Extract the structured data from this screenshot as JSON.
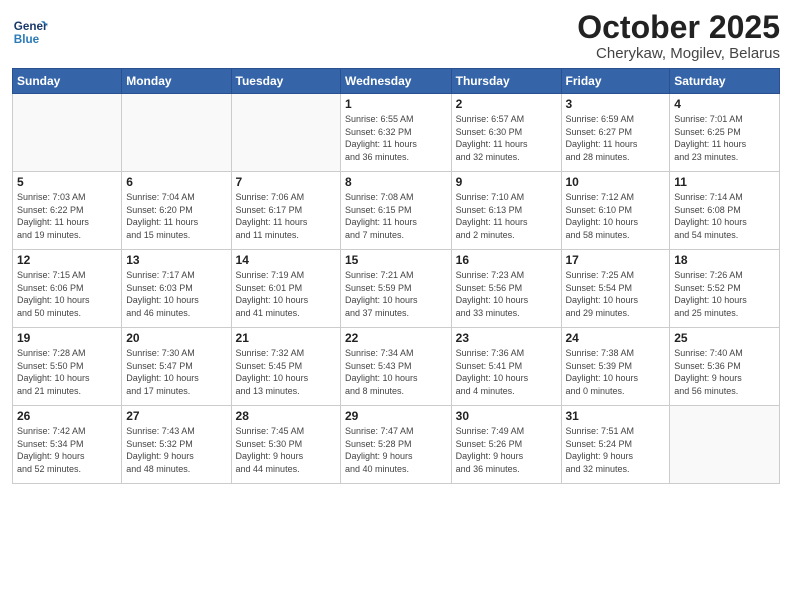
{
  "header": {
    "logo_line1": "General",
    "logo_line2": "Blue",
    "title": "October 2025",
    "subtitle": "Cherykaw, Mogilev, Belarus"
  },
  "calendar": {
    "days_of_week": [
      "Sunday",
      "Monday",
      "Tuesday",
      "Wednesday",
      "Thursday",
      "Friday",
      "Saturday"
    ],
    "weeks": [
      [
        {
          "day": "",
          "info": ""
        },
        {
          "day": "",
          "info": ""
        },
        {
          "day": "",
          "info": ""
        },
        {
          "day": "1",
          "info": "Sunrise: 6:55 AM\nSunset: 6:32 PM\nDaylight: 11 hours\nand 36 minutes."
        },
        {
          "day": "2",
          "info": "Sunrise: 6:57 AM\nSunset: 6:30 PM\nDaylight: 11 hours\nand 32 minutes."
        },
        {
          "day": "3",
          "info": "Sunrise: 6:59 AM\nSunset: 6:27 PM\nDaylight: 11 hours\nand 28 minutes."
        },
        {
          "day": "4",
          "info": "Sunrise: 7:01 AM\nSunset: 6:25 PM\nDaylight: 11 hours\nand 23 minutes."
        }
      ],
      [
        {
          "day": "5",
          "info": "Sunrise: 7:03 AM\nSunset: 6:22 PM\nDaylight: 11 hours\nand 19 minutes."
        },
        {
          "day": "6",
          "info": "Sunrise: 7:04 AM\nSunset: 6:20 PM\nDaylight: 11 hours\nand 15 minutes."
        },
        {
          "day": "7",
          "info": "Sunrise: 7:06 AM\nSunset: 6:17 PM\nDaylight: 11 hours\nand 11 minutes."
        },
        {
          "day": "8",
          "info": "Sunrise: 7:08 AM\nSunset: 6:15 PM\nDaylight: 11 hours\nand 7 minutes."
        },
        {
          "day": "9",
          "info": "Sunrise: 7:10 AM\nSunset: 6:13 PM\nDaylight: 11 hours\nand 2 minutes."
        },
        {
          "day": "10",
          "info": "Sunrise: 7:12 AM\nSunset: 6:10 PM\nDaylight: 10 hours\nand 58 minutes."
        },
        {
          "day": "11",
          "info": "Sunrise: 7:14 AM\nSunset: 6:08 PM\nDaylight: 10 hours\nand 54 minutes."
        }
      ],
      [
        {
          "day": "12",
          "info": "Sunrise: 7:15 AM\nSunset: 6:06 PM\nDaylight: 10 hours\nand 50 minutes."
        },
        {
          "day": "13",
          "info": "Sunrise: 7:17 AM\nSunset: 6:03 PM\nDaylight: 10 hours\nand 46 minutes."
        },
        {
          "day": "14",
          "info": "Sunrise: 7:19 AM\nSunset: 6:01 PM\nDaylight: 10 hours\nand 41 minutes."
        },
        {
          "day": "15",
          "info": "Sunrise: 7:21 AM\nSunset: 5:59 PM\nDaylight: 10 hours\nand 37 minutes."
        },
        {
          "day": "16",
          "info": "Sunrise: 7:23 AM\nSunset: 5:56 PM\nDaylight: 10 hours\nand 33 minutes."
        },
        {
          "day": "17",
          "info": "Sunrise: 7:25 AM\nSunset: 5:54 PM\nDaylight: 10 hours\nand 29 minutes."
        },
        {
          "day": "18",
          "info": "Sunrise: 7:26 AM\nSunset: 5:52 PM\nDaylight: 10 hours\nand 25 minutes."
        }
      ],
      [
        {
          "day": "19",
          "info": "Sunrise: 7:28 AM\nSunset: 5:50 PM\nDaylight: 10 hours\nand 21 minutes."
        },
        {
          "day": "20",
          "info": "Sunrise: 7:30 AM\nSunset: 5:47 PM\nDaylight: 10 hours\nand 17 minutes."
        },
        {
          "day": "21",
          "info": "Sunrise: 7:32 AM\nSunset: 5:45 PM\nDaylight: 10 hours\nand 13 minutes."
        },
        {
          "day": "22",
          "info": "Sunrise: 7:34 AM\nSunset: 5:43 PM\nDaylight: 10 hours\nand 8 minutes."
        },
        {
          "day": "23",
          "info": "Sunrise: 7:36 AM\nSunset: 5:41 PM\nDaylight: 10 hours\nand 4 minutes."
        },
        {
          "day": "24",
          "info": "Sunrise: 7:38 AM\nSunset: 5:39 PM\nDaylight: 10 hours\nand 0 minutes."
        },
        {
          "day": "25",
          "info": "Sunrise: 7:40 AM\nSunset: 5:36 PM\nDaylight: 9 hours\nand 56 minutes."
        }
      ],
      [
        {
          "day": "26",
          "info": "Sunrise: 7:42 AM\nSunset: 5:34 PM\nDaylight: 9 hours\nand 52 minutes."
        },
        {
          "day": "27",
          "info": "Sunrise: 7:43 AM\nSunset: 5:32 PM\nDaylight: 9 hours\nand 48 minutes."
        },
        {
          "day": "28",
          "info": "Sunrise: 7:45 AM\nSunset: 5:30 PM\nDaylight: 9 hours\nand 44 minutes."
        },
        {
          "day": "29",
          "info": "Sunrise: 7:47 AM\nSunset: 5:28 PM\nDaylight: 9 hours\nand 40 minutes."
        },
        {
          "day": "30",
          "info": "Sunrise: 7:49 AM\nSunset: 5:26 PM\nDaylight: 9 hours\nand 36 minutes."
        },
        {
          "day": "31",
          "info": "Sunrise: 7:51 AM\nSunset: 5:24 PM\nDaylight: 9 hours\nand 32 minutes."
        },
        {
          "day": "",
          "info": ""
        }
      ]
    ]
  }
}
